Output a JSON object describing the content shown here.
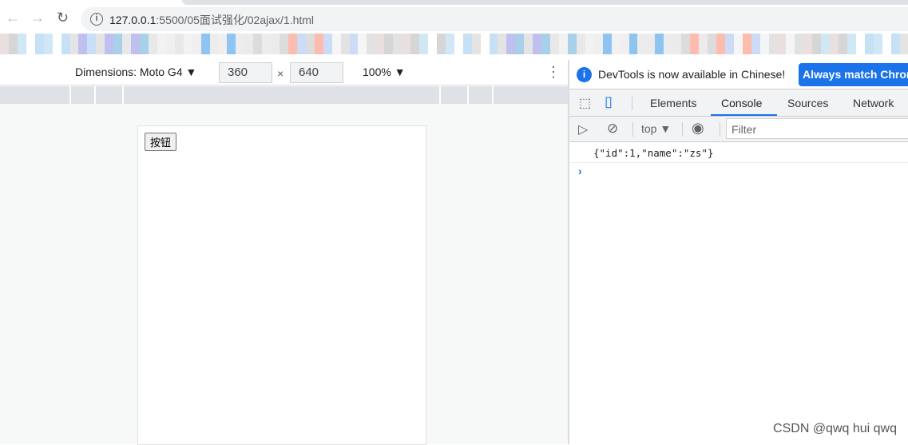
{
  "browser": {
    "url_host": "127.0.0.1",
    "url_rest": ":5500/05面试强化/02ajax/1.html",
    "back_icon": "arrow-left-icon",
    "forward_icon": "arrow-right-icon",
    "reload_icon": "reload-icon"
  },
  "device_toolbar": {
    "dimensions_label": "Dimensions: Moto G4 ▼",
    "width": "360",
    "height": "640",
    "times": "×",
    "zoom": "100% ▼"
  },
  "page": {
    "button_label": "按钮"
  },
  "devtools": {
    "banner_text": "DevTools is now available in Chinese!",
    "banner_button": "Always match Chrome's language",
    "tabs": [
      "Elements",
      "Console",
      "Sources",
      "Network"
    ],
    "active_tab": "Console",
    "context": "top ▼",
    "filter_placeholder": "Filter",
    "log": "{\"id\":1,\"name\":\"zs\"}",
    "prompt": "›",
    "accent": "#1a73e8"
  },
  "watermark": "CSDN @qwq hui qwq"
}
